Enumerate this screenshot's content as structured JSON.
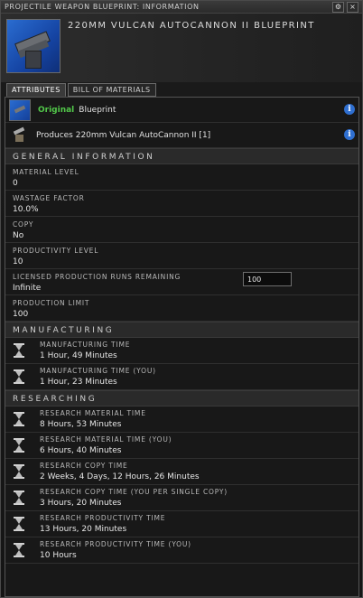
{
  "window": {
    "title": "PROJECTILE WEAPON BLUEPRINT: INFORMATION"
  },
  "header": {
    "item_name": "220MM VULCAN AUTOCANNON II BLUEPRINT"
  },
  "tabs": [
    {
      "label": "ATTRIBUTES"
    },
    {
      "label": "BILL OF MATERIALS"
    }
  ],
  "summary": {
    "original_label": "Original",
    "blueprint_label": "Blueprint",
    "produces_text": "Produces 220mm Vulcan AutoCannon II [1]"
  },
  "general": {
    "title": "GENERAL INFORMATION",
    "items": [
      {
        "label": "MATERIAL LEVEL",
        "value": "0"
      },
      {
        "label": "WASTAGE FACTOR",
        "value": "10.0%"
      },
      {
        "label": "COPY",
        "value": "No"
      },
      {
        "label": "PRODUCTIVITY LEVEL",
        "value": "10"
      },
      {
        "label": "LICENSED PRODUCTION RUNS REMAINING",
        "value": "Infinite"
      },
      {
        "label": "PRODUCTION LIMIT",
        "value": "100"
      }
    ],
    "runs_input_value": "100"
  },
  "manufacturing": {
    "title": "MANUFACTURING",
    "items": [
      {
        "label": "MANUFACTURING TIME",
        "value": "1 Hour, 49 Minutes"
      },
      {
        "label": "MANUFACTURING TIME (YOU)",
        "value": "1 Hour, 23 Minutes"
      }
    ]
  },
  "researching": {
    "title": "RESEARCHING",
    "items": [
      {
        "label": "RESEARCH MATERIAL TIME",
        "value": "8 Hours, 53 Minutes"
      },
      {
        "label": "RESEARCH MATERIAL TIME (YOU)",
        "value": "6 Hours, 40 Minutes"
      },
      {
        "label": "RESEARCH COPY TIME",
        "value": "2 Weeks, 4 Days, 12 Hours, 26 Minutes"
      },
      {
        "label": "RESEARCH COPY TIME (YOU PER SINGLE COPY)",
        "value": "3 Hours, 20 Minutes"
      },
      {
        "label": "RESEARCH PRODUCTIVITY TIME",
        "value": "13 Hours, 20 Minutes"
      },
      {
        "label": "RESEARCH PRODUCTIVITY TIME (YOU)",
        "value": "10 Hours"
      }
    ]
  },
  "icons": {
    "info": "info-icon",
    "hourglass": "hourglass-icon",
    "blueprint": "blueprint-icon",
    "product": "autocannon-icon"
  },
  "colors": {
    "original_green": "#52c84a",
    "info_blue": "#2f6fd0"
  }
}
